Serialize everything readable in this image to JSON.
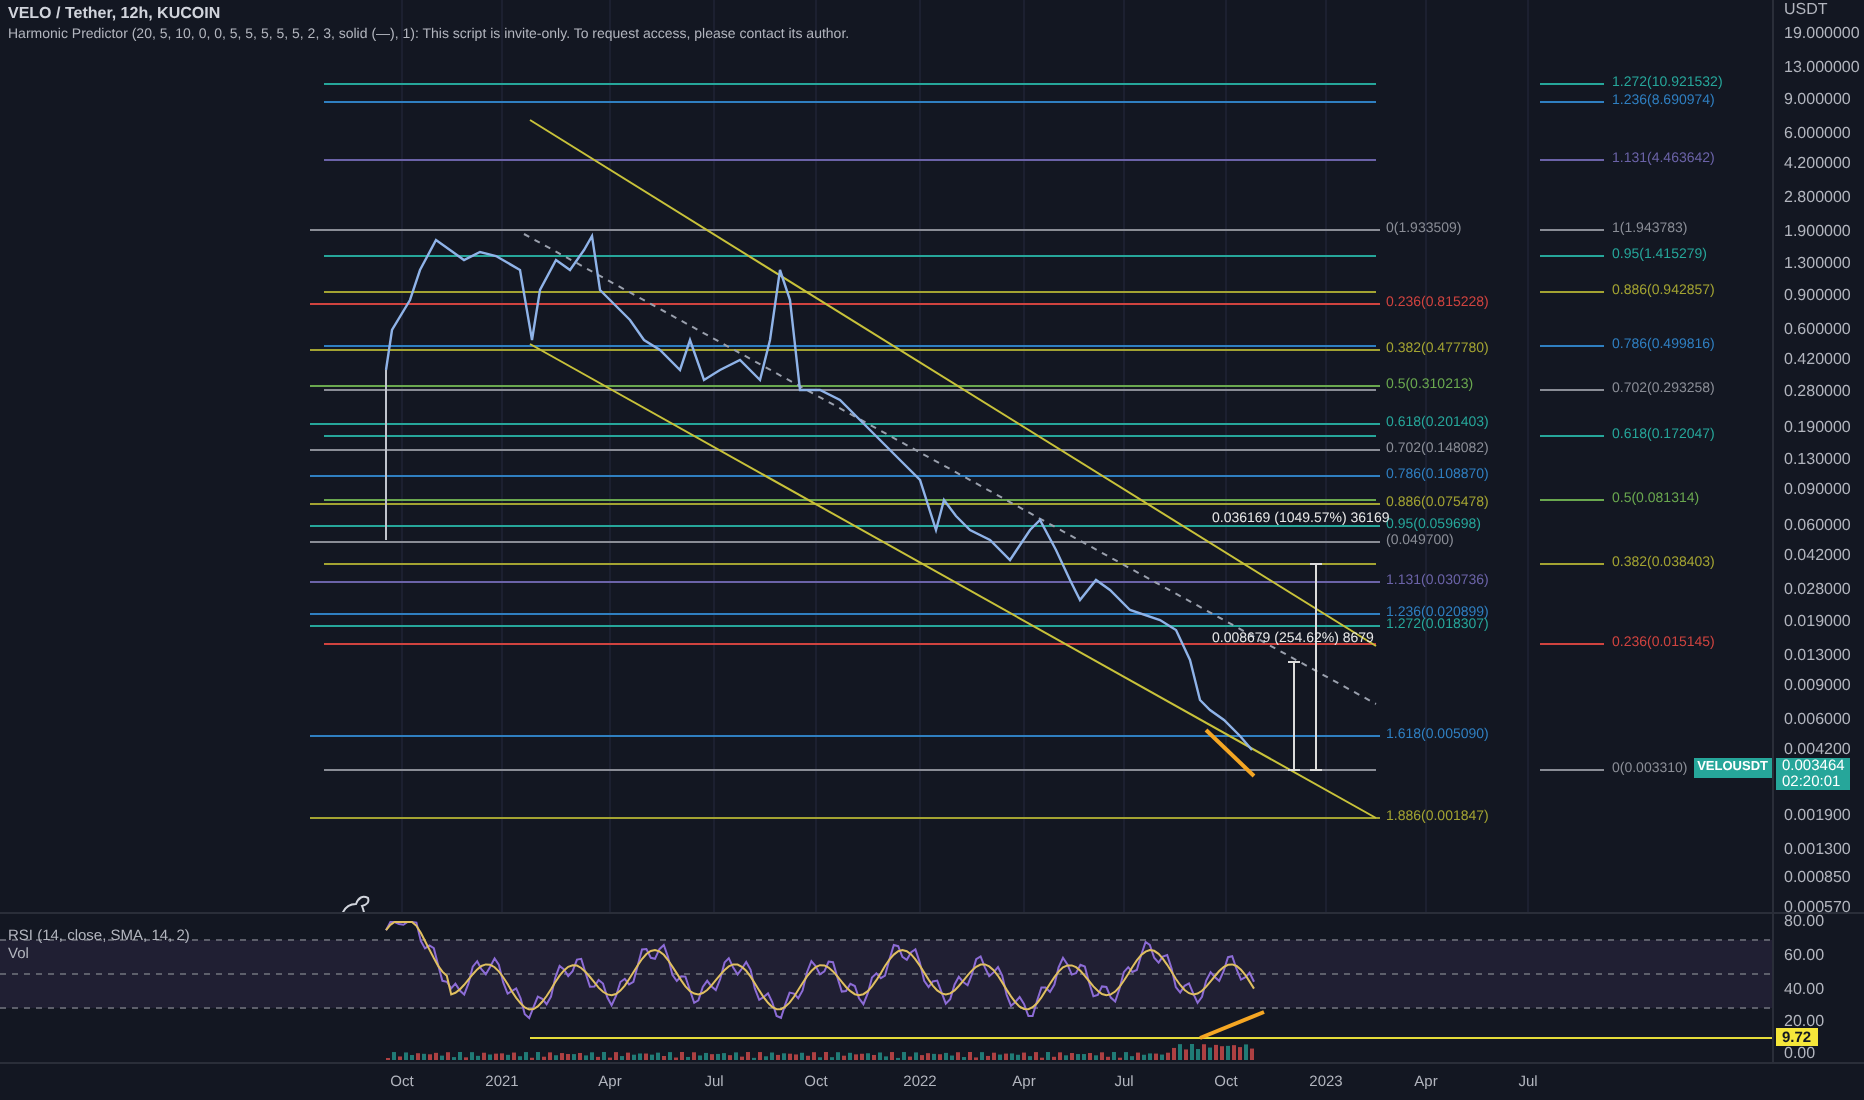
{
  "header": {
    "symbol_line": "VELO / Tether, 12h, KUCOIN",
    "indicator_line": "Harmonic Predictor (20, 5, 10, 0, 0, 5, 5, 5, 5, 5, 2, 3, solid (—), 1): This script is invite-only. To request access, please contact its author."
  },
  "price_axis": {
    "unit": "USDT",
    "ticks": [
      "19.000000",
      "13.000000",
      "9.000000",
      "6.000000",
      "4.200000",
      "2.800000",
      "1.900000",
      "1.300000",
      "0.900000",
      "0.600000",
      "0.420000",
      "0.280000",
      "0.190000",
      "0.130000",
      "0.090000",
      "0.060000",
      "0.042000",
      "0.028000",
      "0.019000",
      "0.013000",
      "0.009000",
      "0.006000",
      "0.004200",
      "0.001900",
      "0.001300",
      "0.000850",
      "0.000570"
    ]
  },
  "fib_right": [
    {
      "label": "1.272(10.921532)",
      "color": "#26a69a"
    },
    {
      "label": "1.236(8.690974)",
      "color": "#2f7fc1"
    },
    {
      "label": "1.131(4.463642)",
      "color": "#6b63a8"
    },
    {
      "label": "1(1.943783)",
      "color": "#8a8d96"
    },
    {
      "label": "0.95(1.415279)",
      "color": "#26a69a"
    },
    {
      "label": "0.886(0.942857)",
      "color": "#a3a332"
    },
    {
      "label": "0.786(0.499816)",
      "color": "#2f7fc1"
    },
    {
      "label": "0.702(0.293258)",
      "color": "#8a8d96"
    },
    {
      "label": "0.618(0.172047)",
      "color": "#26a69a"
    },
    {
      "label": "0.5(0.081314)",
      "color": "#6aa84f"
    },
    {
      "label": "0.382(0.038403)",
      "color": "#a3a332"
    },
    {
      "label": "0.236(0.015145)",
      "color": "#d0433f"
    },
    {
      "label": "0(0.003310)",
      "color": "#8a8d96"
    }
  ],
  "fib_left": [
    {
      "label": "0(1.933509)",
      "color": "#8a8d96"
    },
    {
      "label": "0.236(0.815228)",
      "color": "#d0433f"
    },
    {
      "label": "0.382(0.477780)",
      "color": "#a3a332"
    },
    {
      "label": "0.5(0.310213)",
      "color": "#6aa84f"
    },
    {
      "label": "0.618(0.201403)",
      "color": "#26a69a"
    },
    {
      "label": "0.702(0.148082)",
      "color": "#8a8d96"
    },
    {
      "label": "0.786(0.108870)",
      "color": "#2f7fc1"
    },
    {
      "label": "0.886(0.075478)",
      "color": "#a3a332"
    },
    {
      "label": "0.95(0.059698)",
      "color": "#26a69a"
    },
    {
      "label": "(0.049700)",
      "color": "#8a8d96"
    },
    {
      "label": "1.131(0.030736)",
      "color": "#6b63a8"
    },
    {
      "label": "1.236(0.020899)",
      "color": "#2f7fc1"
    },
    {
      "label": "1.272(0.018307)",
      "color": "#26a69a"
    },
    {
      "label": "1.618(0.005090)",
      "color": "#2f7fc1"
    },
    {
      "label": "1.886(0.001847)",
      "color": "#a3a332"
    }
  ],
  "measurements": [
    {
      "label": "0.036169 (1049.57%) 36169"
    },
    {
      "label": "0.008679 (254.62%) 8679"
    }
  ],
  "price_badge": {
    "symbol": "VELOUSDT",
    "price": "0.003464",
    "countdown": "02:20:01"
  },
  "rsi": {
    "legend": "RSI (14, close, SMA, 14, 2)",
    "volume_legend": "Vol",
    "ticks": [
      "80.00",
      "60.00",
      "40.00",
      "20.00",
      "0.00"
    ],
    "badge": "9.72"
  },
  "time_axis": [
    "Oct",
    "2021",
    "Apr",
    "Jul",
    "Oct",
    "2022",
    "Apr",
    "Jul",
    "Oct",
    "2023",
    "Apr",
    "Jul"
  ]
}
